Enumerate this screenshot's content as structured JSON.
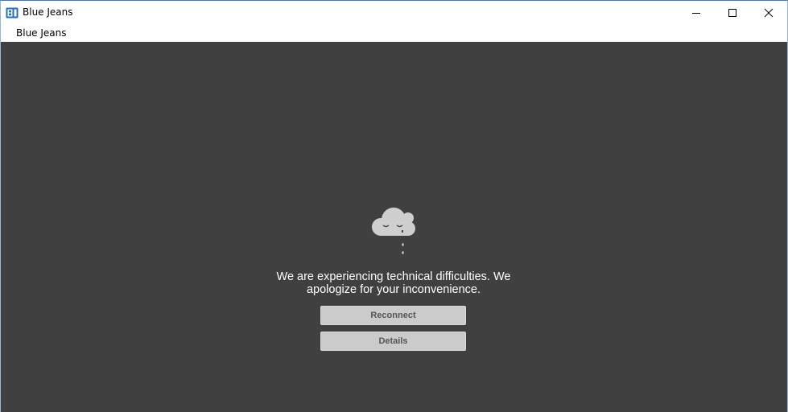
{
  "window": {
    "title": "Blue Jeans",
    "app_icon": "bluejeans-logo-icon",
    "controls": {
      "minimize_icon": "minimize-icon",
      "maximize_icon": "maximize-icon",
      "close_icon": "close-icon"
    }
  },
  "menubar": {
    "items": [
      {
        "label": "Blue Jeans"
      }
    ]
  },
  "main": {
    "illustration": "sad-crying-cloud-icon",
    "message": "We are experiencing technical difficulties. We apologize for your inconvenience.",
    "buttons": {
      "reconnect": "Reconnect",
      "details": "Details"
    }
  },
  "colors": {
    "content_background": "#404040",
    "button_background": "#cbcbcb",
    "button_text": "#555555",
    "message_text": "#ffffff",
    "brand_blue": "#1f6fc5"
  }
}
